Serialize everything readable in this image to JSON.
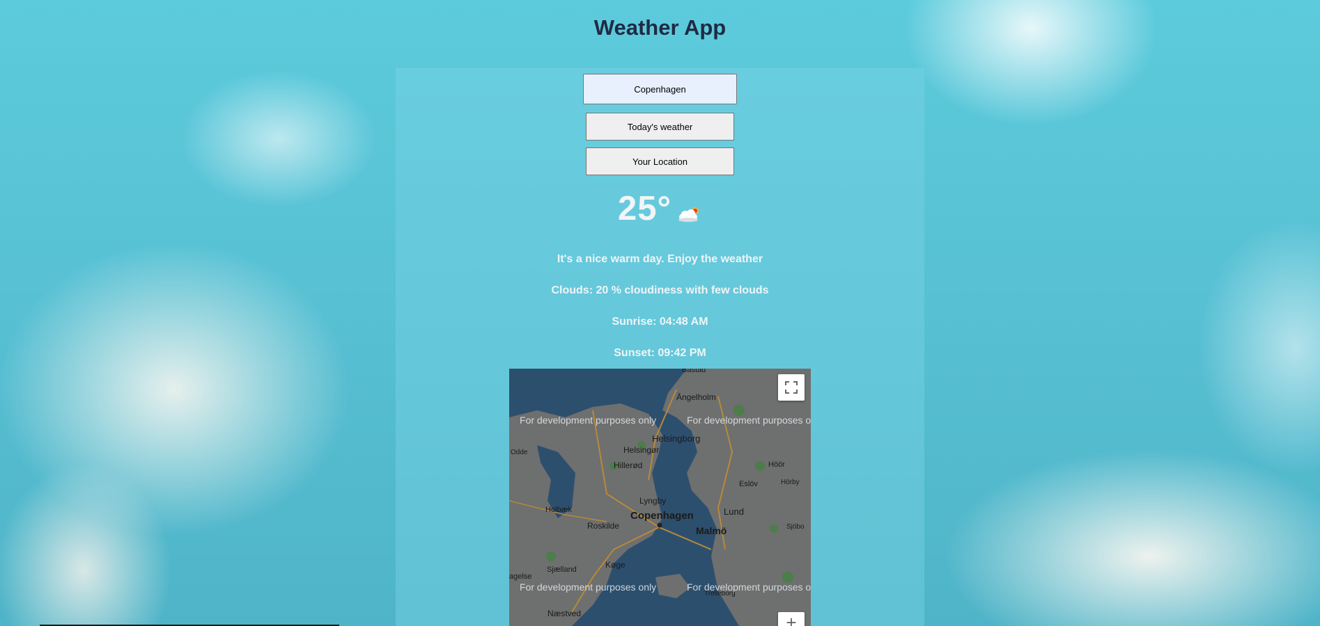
{
  "app": {
    "title": "Weather App"
  },
  "search": {
    "value": "Copenhagen"
  },
  "buttons": {
    "today": "Today's weather",
    "location": "Your Location"
  },
  "weather": {
    "temperature": "25°",
    "icon": "sun-behind-cloud-icon",
    "description": "It's a nice warm day. Enjoy the weather",
    "clouds": "Clouds: 20 % cloudiness with few clouds",
    "sunrise": "Sunrise: 04:48 AM",
    "sunset": "Sunset: 09:42 PM"
  },
  "map": {
    "watermark": "For development purposes only",
    "places": {
      "bastad": "Båstad",
      "angelholm": "Ängelholm",
      "helsingborg": "Helsingborg",
      "helsingor": "Helsingør",
      "hilleroed": "Hillerød",
      "lyngby": "Lyngby",
      "copenhagen": "Copenhagen",
      "roskilde": "Roskilde",
      "holbaek": "Holbæk",
      "malmo": "Malmö",
      "lund": "Lund",
      "eslov": "Eslöv",
      "hoor": "Höör",
      "horby": "Hörby",
      "sjobo": "Sjöbo",
      "koege": "Køge",
      "sjaelland": "Sjælland",
      "naestved": "Næstved",
      "trelleborg": "Trelleborg",
      "odde": "Odde",
      "zealand_west": "agelse"
    },
    "controls": {
      "fullscreen": "fullscreen-icon",
      "zoom_in": "+"
    }
  }
}
